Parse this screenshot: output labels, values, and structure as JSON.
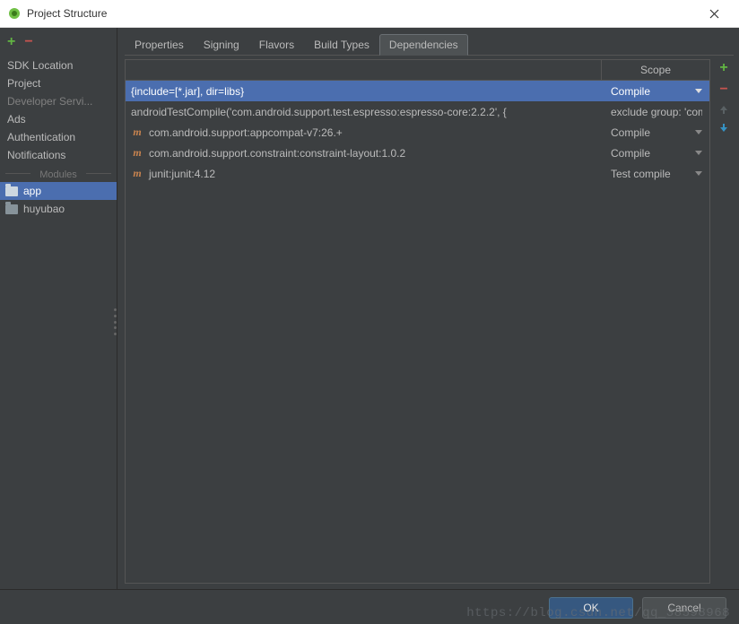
{
  "window": {
    "title": "Project Structure"
  },
  "sidebar": {
    "items": [
      {
        "label": "SDK Location"
      },
      {
        "label": "Project"
      },
      {
        "label": "Developer Servi..."
      },
      {
        "label": "Ads"
      },
      {
        "label": "Authentication"
      },
      {
        "label": "Notifications"
      }
    ],
    "modules_header": "Modules",
    "modules": [
      {
        "label": "app",
        "selected": true
      },
      {
        "label": "huyubao",
        "selected": false
      }
    ]
  },
  "tabs": [
    {
      "label": "Properties",
      "active": false
    },
    {
      "label": "Signing",
      "active": false
    },
    {
      "label": "Flavors",
      "active": false
    },
    {
      "label": "Build Types",
      "active": false
    },
    {
      "label": "Dependencies",
      "active": true
    }
  ],
  "dep_table": {
    "scope_header": "Scope",
    "rows": [
      {
        "icon": "",
        "name": "{include=[*.jar], dir=libs}",
        "scope": "Compile",
        "scope_suffix": "",
        "selected": true
      },
      {
        "icon": "",
        "name": "androidTestCompile('com.android.support.test.espresso:espresso-core:2.2.2', {",
        "scope": "",
        "scope_suffix": "exclude group: 'com.android.support', module: 'support-annotations' })",
        "selected": false
      },
      {
        "icon": "m",
        "name": "com.android.support:appcompat-v7:26.+",
        "scope": "Compile",
        "scope_suffix": "",
        "selected": false
      },
      {
        "icon": "m",
        "name": "com.android.support.constraint:constraint-layout:1.0.2",
        "scope": "Compile",
        "scope_suffix": "",
        "selected": false
      },
      {
        "icon": "m",
        "name": "junit:junit:4.12",
        "scope": "Test compile",
        "scope_suffix": "",
        "selected": false
      }
    ]
  },
  "buttons": {
    "ok": "OK",
    "cancel": "Cancel"
  },
  "watermark": "https://blog.csdn.net/qq_38598968"
}
